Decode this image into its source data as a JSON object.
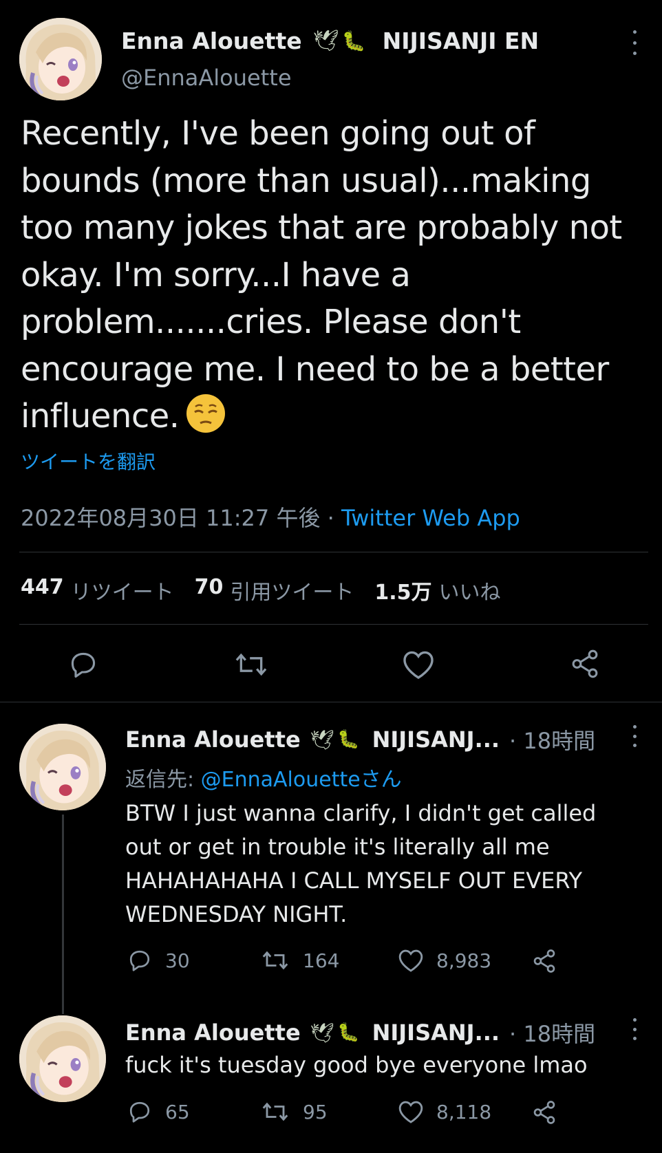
{
  "main_tweet": {
    "display_name": "Enna Alouette",
    "affiliation": "NIJISANJI EN",
    "handle": "@EnnaAlouette",
    "emoji_bird": "🕊",
    "emoji_bug": "🐛",
    "text_lines": [
      "Recently, I've been going out of",
      "bounds (more than usual)...making",
      "too many jokes that are probably not",
      "okay. I'm sorry...I have a",
      "problem.......cries. Please don't",
      "encourage me. I need to be a better",
      "influence."
    ],
    "translate_label": "ツイートを翻訳",
    "timestamp": "2022年08月30日 11:27 午後",
    "separator": " · ",
    "source": "Twitter Web App",
    "stats": [
      {
        "value": "447",
        "label": "リツイート"
      },
      {
        "value": "70",
        "label": "引用ツイート"
      },
      {
        "value": "1.5万",
        "label": "いいね"
      }
    ],
    "icons": [
      "reply-icon",
      "retweet-icon",
      "like-icon",
      "share-icon"
    ]
  },
  "replies": [
    {
      "display_name": "Enna Alouette",
      "affiliation": "NIJISANJ...",
      "time": "· 18時間",
      "reply_to_prefix": "返信先: ",
      "reply_to_handle": "@EnnaAlouetteさん",
      "text_lines": [
        "BTW I just wanna clarify, I didn't get called",
        "out or get in trouble it's literally all me",
        "HAHAHAHAHA I CALL MYSELF OUT EVERY",
        "WEDNESDAY NIGHT."
      ],
      "replies_count": "30",
      "retweets_count": "164",
      "likes_count": "8,983"
    },
    {
      "display_name": "Enna Alouette",
      "affiliation": "NIJISANJ...",
      "time": "· 18時間",
      "text_lines": [
        "fuck it's tuesday good bye everyone lmao"
      ],
      "replies_count": "65",
      "retweets_count": "95",
      "likes_count": "8,118"
    }
  ],
  "colors": {
    "background": "#000000",
    "text": "#e7e9ea",
    "secondary": "#8b98a5",
    "link": "#1d9bf0",
    "divider": "#2f3336"
  }
}
